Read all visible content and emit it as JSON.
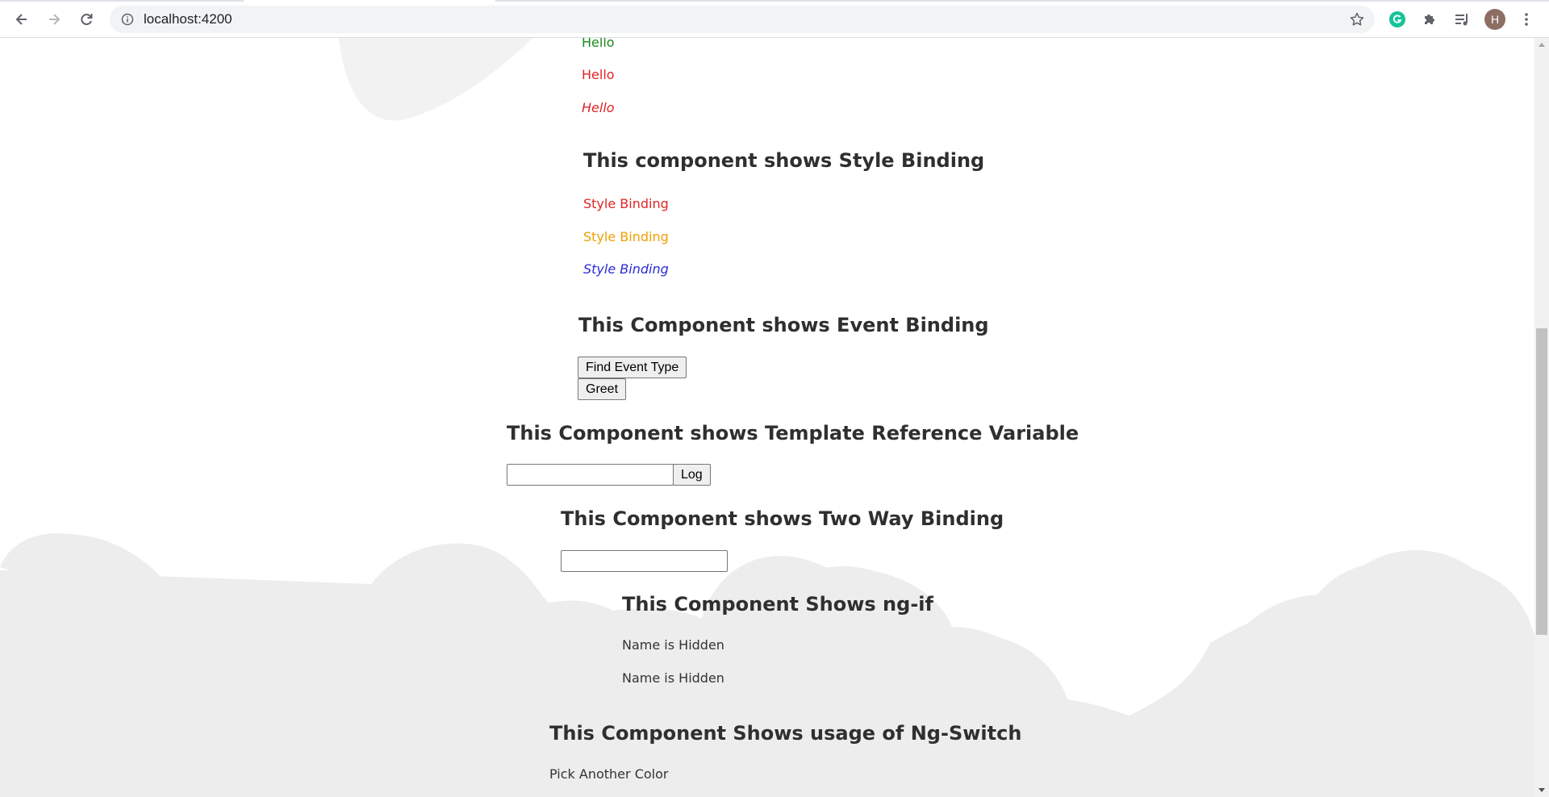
{
  "browser": {
    "url": "localhost:4200",
    "profile_initial": "H",
    "icons": {
      "back": "arrow-left-icon",
      "forward": "arrow-right-icon",
      "reload": "reload-icon",
      "site_info": "info-icon",
      "bookmark": "star-icon",
      "grammarly": "grammarly-icon",
      "extensions": "puzzle-icon",
      "media": "media-queue-icon",
      "menu": "kebab-menu-icon"
    }
  },
  "colors": {
    "green": "#1a8a1a",
    "red": "#e02424",
    "orange": "#f0a000",
    "blue": "#2b2bd6",
    "cloud": "#ededed",
    "grammarly": "#15c39a"
  },
  "class_binding": {
    "items": [
      "Hello",
      "Hello",
      "Hello"
    ]
  },
  "style_binding": {
    "title": "This component shows Style Binding",
    "items": [
      "Style Binding",
      "Style Binding",
      "Style Binding"
    ]
  },
  "event_binding": {
    "title": "This Component shows Event Binding",
    "find_event_button": "Find Event Type",
    "greet_button": "Greet"
  },
  "template_ref": {
    "title": "This Component shows Template Reference Variable",
    "input_value": "",
    "log_button": "Log"
  },
  "two_way": {
    "title": "This Component shows Two Way Binding",
    "input_value": ""
  },
  "ng_if": {
    "title": "This Component Shows ng-if",
    "lines": [
      "Name is Hidden",
      "Name is Hidden"
    ]
  },
  "ng_switch": {
    "title": "This Component Shows usage of Ng-Switch",
    "text": "Pick Another Color"
  }
}
